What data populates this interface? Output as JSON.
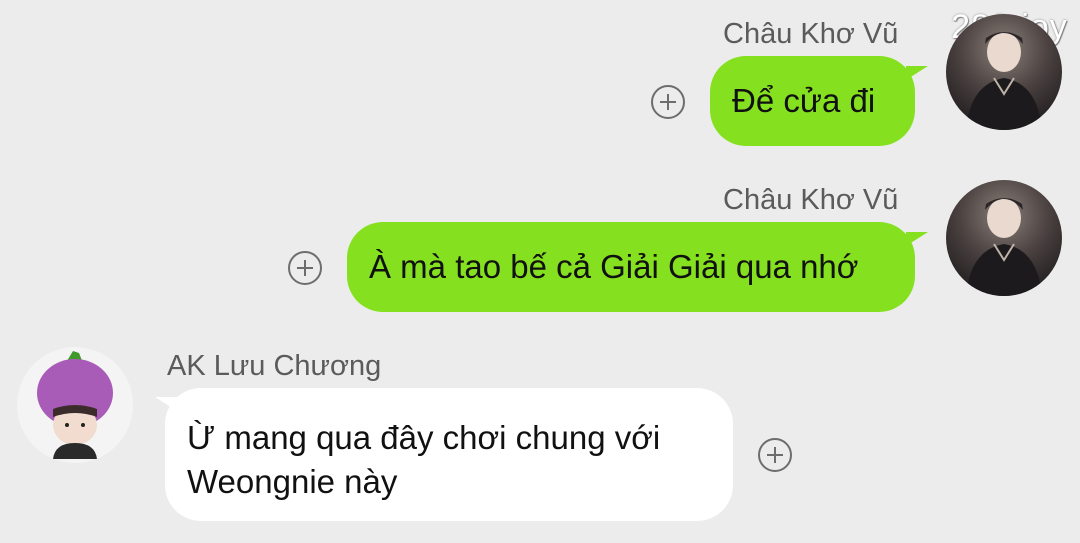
{
  "watermark": "282 joy",
  "messages": [
    {
      "sender": "Châu Khơ Vũ",
      "text": "Để cửa đi",
      "direction": "outgoing"
    },
    {
      "sender": "Châu Khơ Vũ",
      "text": "À mà tao bế cả Giải Giải qua nhớ",
      "direction": "outgoing"
    },
    {
      "sender": "AK Lưu Chương",
      "text_lines": [
        "Ừ mang qua đây chơi chung với",
        "Weongnie này"
      ],
      "direction": "incoming"
    }
  ],
  "icons": {
    "react": "plus-circle-icon",
    "avatar_outgoing": "avatar-boy",
    "avatar_incoming": "avatar-eggplant-hat"
  },
  "colors": {
    "background": "#ececec",
    "outgoing_bubble": "#85e11f",
    "incoming_bubble": "#ffffff",
    "sender_name": "#5b5b5b"
  }
}
